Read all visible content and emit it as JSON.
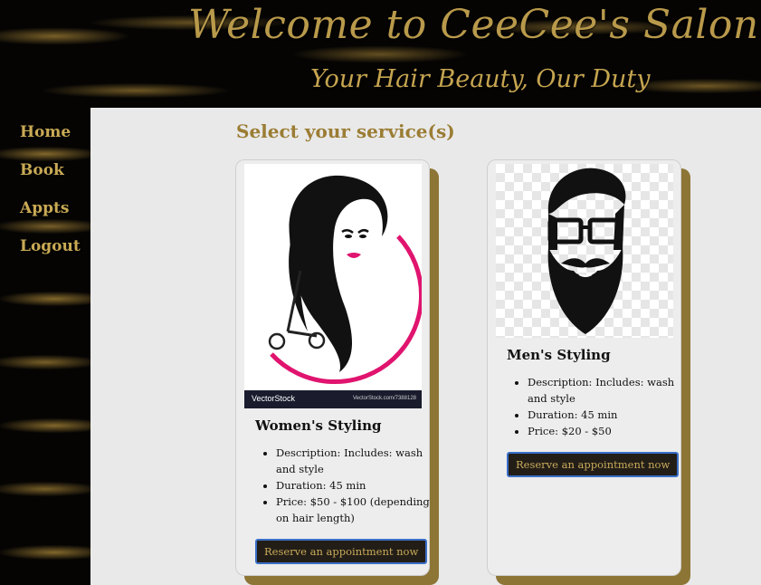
{
  "header": {
    "title": "Welcome to CeeCee's Salon",
    "tagline": "Your Hair Beauty, Our Duty"
  },
  "nav": {
    "items": [
      {
        "label": "Home"
      },
      {
        "label": "Book"
      },
      {
        "label": "Appts"
      },
      {
        "label": "Logout"
      }
    ]
  },
  "main": {
    "section_title": "Select your service(s)"
  },
  "services": [
    {
      "title": "Women's Styling",
      "details": [
        "Description: Includes: wash and style",
        "Duration: 45 min",
        "Price: $50 - $100 (depending on hair length)"
      ],
      "button_label": "Reserve an appointment now",
      "image": {
        "icon": "woman-face-scissors-icon",
        "watermark_brand": "VectorStock",
        "watermark_url": "VectorStock.com/7388128"
      }
    },
    {
      "title": "Men's Styling",
      "details": [
        "Description: Includes: wash and style",
        "Duration: 45 min",
        "Price: $20 - $50"
      ],
      "button_label": "Reserve an appointment now",
      "image": {
        "icon": "bearded-man-glasses-icon"
      }
    }
  ],
  "colors": {
    "gold": "#c9aa55",
    "panel": "#e9e9e9",
    "card_shadow": "#8d7535",
    "button_bg": "#221d17",
    "button_border": "#3a6fc8",
    "accent_pink": "#e0146f"
  }
}
